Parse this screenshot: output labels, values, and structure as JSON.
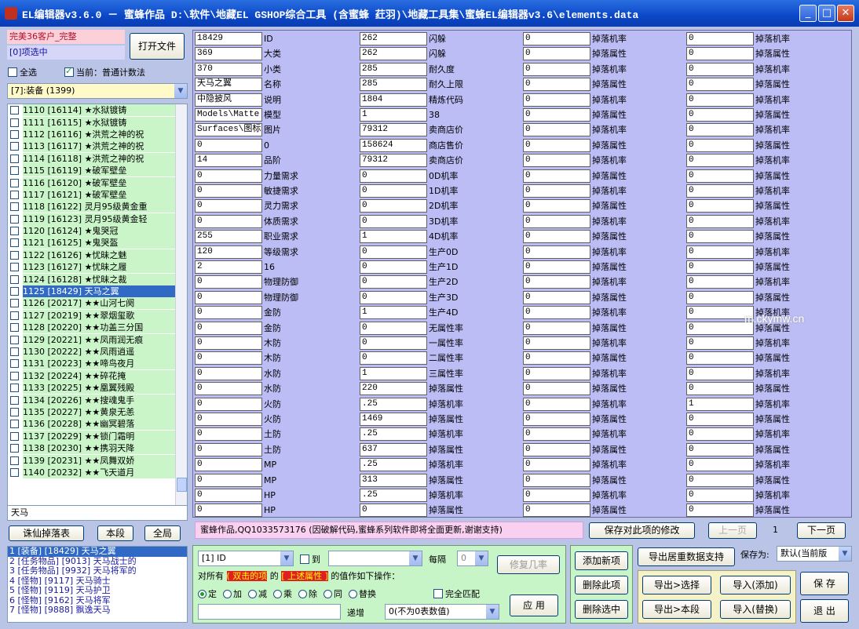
{
  "title": "EL编辑器v3.6.0  －  蜜蜂作品  D:\\软件\\地藏EL GSHOP综合工具 (含蜜蜂 荭羽)\\地藏工具集\\蜜蜂EL编辑器v3.6\\elements.data",
  "window": {
    "min": "_",
    "max": "□",
    "close": "✕"
  },
  "left": {
    "client_label": "完美36客户_完整",
    "selected_count": "[0]项选中",
    "open_file": "打开文件",
    "select_all": "全选",
    "current_label": "当前：普通计数法",
    "category": "[7]:装备 (1399)",
    "items": [
      "1110 [16114] ★水狱镀铸",
      "1111 [16115] ★水狱镀铸",
      "1112 [16116] ★洪荒之神的祝",
      "1113 [16117] ★洪荒之神的祝",
      "1114 [16118] ★洪荒之神的祝",
      "1115 [16119] ★破军壁垒",
      "1116 [16120] ★破军壁垒",
      "1117 [16121] ★破军壁垒",
      "1118 [16122] 灵月95级黄金重",
      "1119 [16123] 灵月95级黄金轻",
      "1120 [16124] ★鬼哭冠",
      "1121 [16125] ★鬼哭盔",
      "1122 [16126] ★忧昧之魅",
      "1123 [16127] ★忧昧之履",
      "1124 [16128] ★忧昧之裁",
      "1125 [18429] 天马之翼",
      "1126 [20217] ★★山河七阕",
      "1127 [20219] ★★翠烟玺歌",
      "1128 [20220] ★★功盖三分国",
      "1129 [20221] ★★凤雨润无痕",
      "1130 [20222] ★★凤雨逍遥",
      "1131 [20223] ★★啼鸟夜月",
      "1132 [20224] ★★碎花掩",
      "1133 [20225] ★★凰翼残殿",
      "1134 [20226] ★★搜魂鬼手",
      "1135 [20227] ★★黄泉无恙",
      "1136 [20228] ★★幽冥碧落",
      "1137 [20229] ★★锁门霜明",
      "1138 [20230] ★★携羽天降",
      "1139 [20231] ★★凤舞双娇",
      "1140 [20232] ★★飞天道月"
    ],
    "selected_index": 15,
    "search_value": "天马",
    "btn_drops": "诛仙掉落表",
    "btn_local": "本段",
    "btn_global": "全局",
    "results": [
      "1 [装备] [18429] 天马之翼",
      "2 [任务物品] [9013] 天马战士的",
      "3 [任务物品] [9932] 天马将军的",
      "4 [怪物] [9117] 天马骑士",
      "5 [怪物] [9119] 天马护卫",
      "6 [怪物] [9162] 天马将军",
      "7 [怪物] [9888] 飘逸天马"
    ]
  },
  "fields": [
    [
      [
        "18429",
        "ID"
      ],
      [
        "262",
        "闪躲"
      ],
      [
        "0",
        "掉落机率"
      ],
      [
        "0",
        "掉落机率"
      ]
    ],
    [
      [
        "369",
        "大类"
      ],
      [
        "262",
        "闪躲"
      ],
      [
        "0",
        "掉落属性"
      ],
      [
        "0",
        "掉落属性"
      ]
    ],
    [
      [
        "370",
        "小类"
      ],
      [
        "285",
        "耐久度"
      ],
      [
        "0",
        "掉落机率"
      ],
      [
        "0",
        "掉落机率"
      ]
    ],
    [
      [
        "天马之翼",
        "名称"
      ],
      [
        "285",
        "耐久上限"
      ],
      [
        "0",
        "掉落属性"
      ],
      [
        "0",
        "掉落属性"
      ]
    ],
    [
      [
        "中隐披风",
        "说明"
      ],
      [
        "1804",
        "精炼代码"
      ],
      [
        "0",
        "掉落机率"
      ],
      [
        "0",
        "掉落机率"
      ]
    ],
    [
      [
        "Models\\Matte",
        "模型"
      ],
      [
        "1",
        "38"
      ],
      [
        "0",
        "掉落属性"
      ],
      [
        "0",
        "掉落属性"
      ]
    ],
    [
      [
        "Surfaces\\图标",
        "图片"
      ],
      [
        "79312",
        "卖商店价"
      ],
      [
        "0",
        "掉落机率"
      ],
      [
        "0",
        "掉落机率"
      ]
    ],
    [
      [
        "0",
        "0"
      ],
      [
        "158624",
        "商店售价"
      ],
      [
        "0",
        "掉落属性"
      ],
      [
        "0",
        "掉落属性"
      ]
    ],
    [
      [
        "14",
        "品阶"
      ],
      [
        "79312",
        "卖商店价"
      ],
      [
        "0",
        "掉落机率"
      ],
      [
        "0",
        "掉落机率"
      ]
    ],
    [
      [
        "0",
        "力量需求"
      ],
      [
        "0",
        "0D机率"
      ],
      [
        "0",
        "掉落属性"
      ],
      [
        "0",
        "掉落属性"
      ]
    ],
    [
      [
        "0",
        "敏捷需求"
      ],
      [
        "0",
        "1D机率"
      ],
      [
        "0",
        "掉落机率"
      ],
      [
        "0",
        "掉落机率"
      ]
    ],
    [
      [
        "0",
        "灵力需求"
      ],
      [
        "0",
        "2D机率"
      ],
      [
        "0",
        "掉落属性"
      ],
      [
        "0",
        "掉落属性"
      ]
    ],
    [
      [
        "0",
        "体质需求"
      ],
      [
        "0",
        "3D机率"
      ],
      [
        "0",
        "掉落机率"
      ],
      [
        "0",
        "掉落机率"
      ]
    ],
    [
      [
        "255",
        "职业需求"
      ],
      [
        "1",
        "4D机率"
      ],
      [
        "0",
        "掉落属性"
      ],
      [
        "0",
        "掉落属性"
      ]
    ],
    [
      [
        "120",
        "等级需求"
      ],
      [
        "0",
        "生产0D"
      ],
      [
        "0",
        "掉落机率"
      ],
      [
        "0",
        "掉落机率"
      ]
    ],
    [
      [
        "2",
        "16"
      ],
      [
        "0",
        "生产1D"
      ],
      [
        "0",
        "掉落属性"
      ],
      [
        "0",
        "掉落属性"
      ]
    ],
    [
      [
        "0",
        "物理防御"
      ],
      [
        "0",
        "生产2D"
      ],
      [
        "0",
        "掉落机率"
      ],
      [
        "0",
        "掉落机率"
      ]
    ],
    [
      [
        "0",
        "物理防御"
      ],
      [
        "0",
        "生产3D"
      ],
      [
        "0",
        "掉落属性"
      ],
      [
        "0",
        "掉落属性"
      ]
    ],
    [
      [
        "0",
        "金防"
      ],
      [
        "1",
        "生产4D"
      ],
      [
        "0",
        "掉落机率"
      ],
      [
        "0",
        "掉落机率"
      ]
    ],
    [
      [
        "0",
        "金防"
      ],
      [
        "0",
        "无属性率"
      ],
      [
        "0",
        "掉落属性"
      ],
      [
        "0",
        "掉落属性"
      ]
    ],
    [
      [
        "0",
        "木防"
      ],
      [
        "0",
        "一属性率"
      ],
      [
        "0",
        "掉落机率"
      ],
      [
        "0",
        "掉落机率"
      ]
    ],
    [
      [
        "0",
        "木防"
      ],
      [
        "0",
        "二属性率"
      ],
      [
        "0",
        "掉落属性"
      ],
      [
        "0",
        "掉落属性"
      ]
    ],
    [
      [
        "0",
        "水防"
      ],
      [
        "1",
        "三属性率"
      ],
      [
        "0",
        "掉落机率"
      ],
      [
        "0",
        "掉落机率"
      ]
    ],
    [
      [
        "0",
        "水防"
      ],
      [
        "220",
        "掉落属性"
      ],
      [
        "0",
        "掉落属性"
      ],
      [
        "0",
        "掉落属性"
      ]
    ],
    [
      [
        "0",
        "火防"
      ],
      [
        ".25",
        "掉落机率"
      ],
      [
        "0",
        "掉落机率"
      ],
      [
        "1",
        "掉落机率"
      ]
    ],
    [
      [
        "0",
        "火防"
      ],
      [
        "1469",
        "掉落属性"
      ],
      [
        "0",
        "掉落属性"
      ],
      [
        "0",
        "掉落属性"
      ]
    ],
    [
      [
        "0",
        "土防"
      ],
      [
        ".25",
        "掉落机率"
      ],
      [
        "0",
        "掉落机率"
      ],
      [
        "0",
        "掉落机率"
      ]
    ],
    [
      [
        "0",
        "土防"
      ],
      [
        "637",
        "掉落属性"
      ],
      [
        "0",
        "掉落属性"
      ],
      [
        "0",
        "掉落属性"
      ]
    ],
    [
      [
        "0",
        "MP"
      ],
      [
        ".25",
        "掉落机率"
      ],
      [
        "0",
        "掉落机率"
      ],
      [
        "0",
        "掉落机率"
      ]
    ],
    [
      [
        "0",
        "MP"
      ],
      [
        "313",
        "掉落属性"
      ],
      [
        "0",
        "掉落属性"
      ],
      [
        "0",
        "掉落属性"
      ]
    ],
    [
      [
        "0",
        "HP"
      ],
      [
        ".25",
        "掉落机率"
      ],
      [
        "0",
        "掉落机率"
      ],
      [
        "0",
        "掉落机率"
      ]
    ],
    [
      [
        "0",
        "HP"
      ],
      [
        "0",
        "掉落属性"
      ],
      [
        "0",
        "掉落属性"
      ],
      [
        "0",
        "掉落属性"
      ]
    ]
  ],
  "status": {
    "text": "蜜蜂作品,QQ1033573176 (因破解代码,蜜蜂系列软件即将全面更新,谢谢支持)",
    "save_mod": "保存对此项的修改",
    "prev": "上一页",
    "page": "1",
    "next": "下一页"
  },
  "batch": {
    "field": "[1] ID",
    "to_label": "到",
    "step_label": "每隔",
    "step_value": "0",
    "fix_btn": "修复几率",
    "for_all": "对所有",
    "red1": "( 双击的项",
    "mid": "的",
    "red2": "[ 上述属性 ]",
    "tail": "的值作如下操作：",
    "ops": [
      "定",
      "加",
      "减",
      "乘",
      "除",
      "同",
      "替换"
    ],
    "full_match": "完全匹配",
    "increment": "递增",
    "inc_combo": "0(不为0表数值)",
    "apply": "应 用"
  },
  "actions": {
    "add": "添加新项",
    "del": "删除此项",
    "del_sel": "删除选中",
    "export_npc": "导出居重数据支持",
    "export_sel": "导出>选择",
    "export_seg": "导出>本段",
    "import_add": "导入(添加)",
    "import_rep": "导入(替换)",
    "save_as_label": "保存为:",
    "save_as": "默认(当前版",
    "save": "保 存",
    "exit": "退 出"
  },
  "watermark": "m.ckymw.cn"
}
